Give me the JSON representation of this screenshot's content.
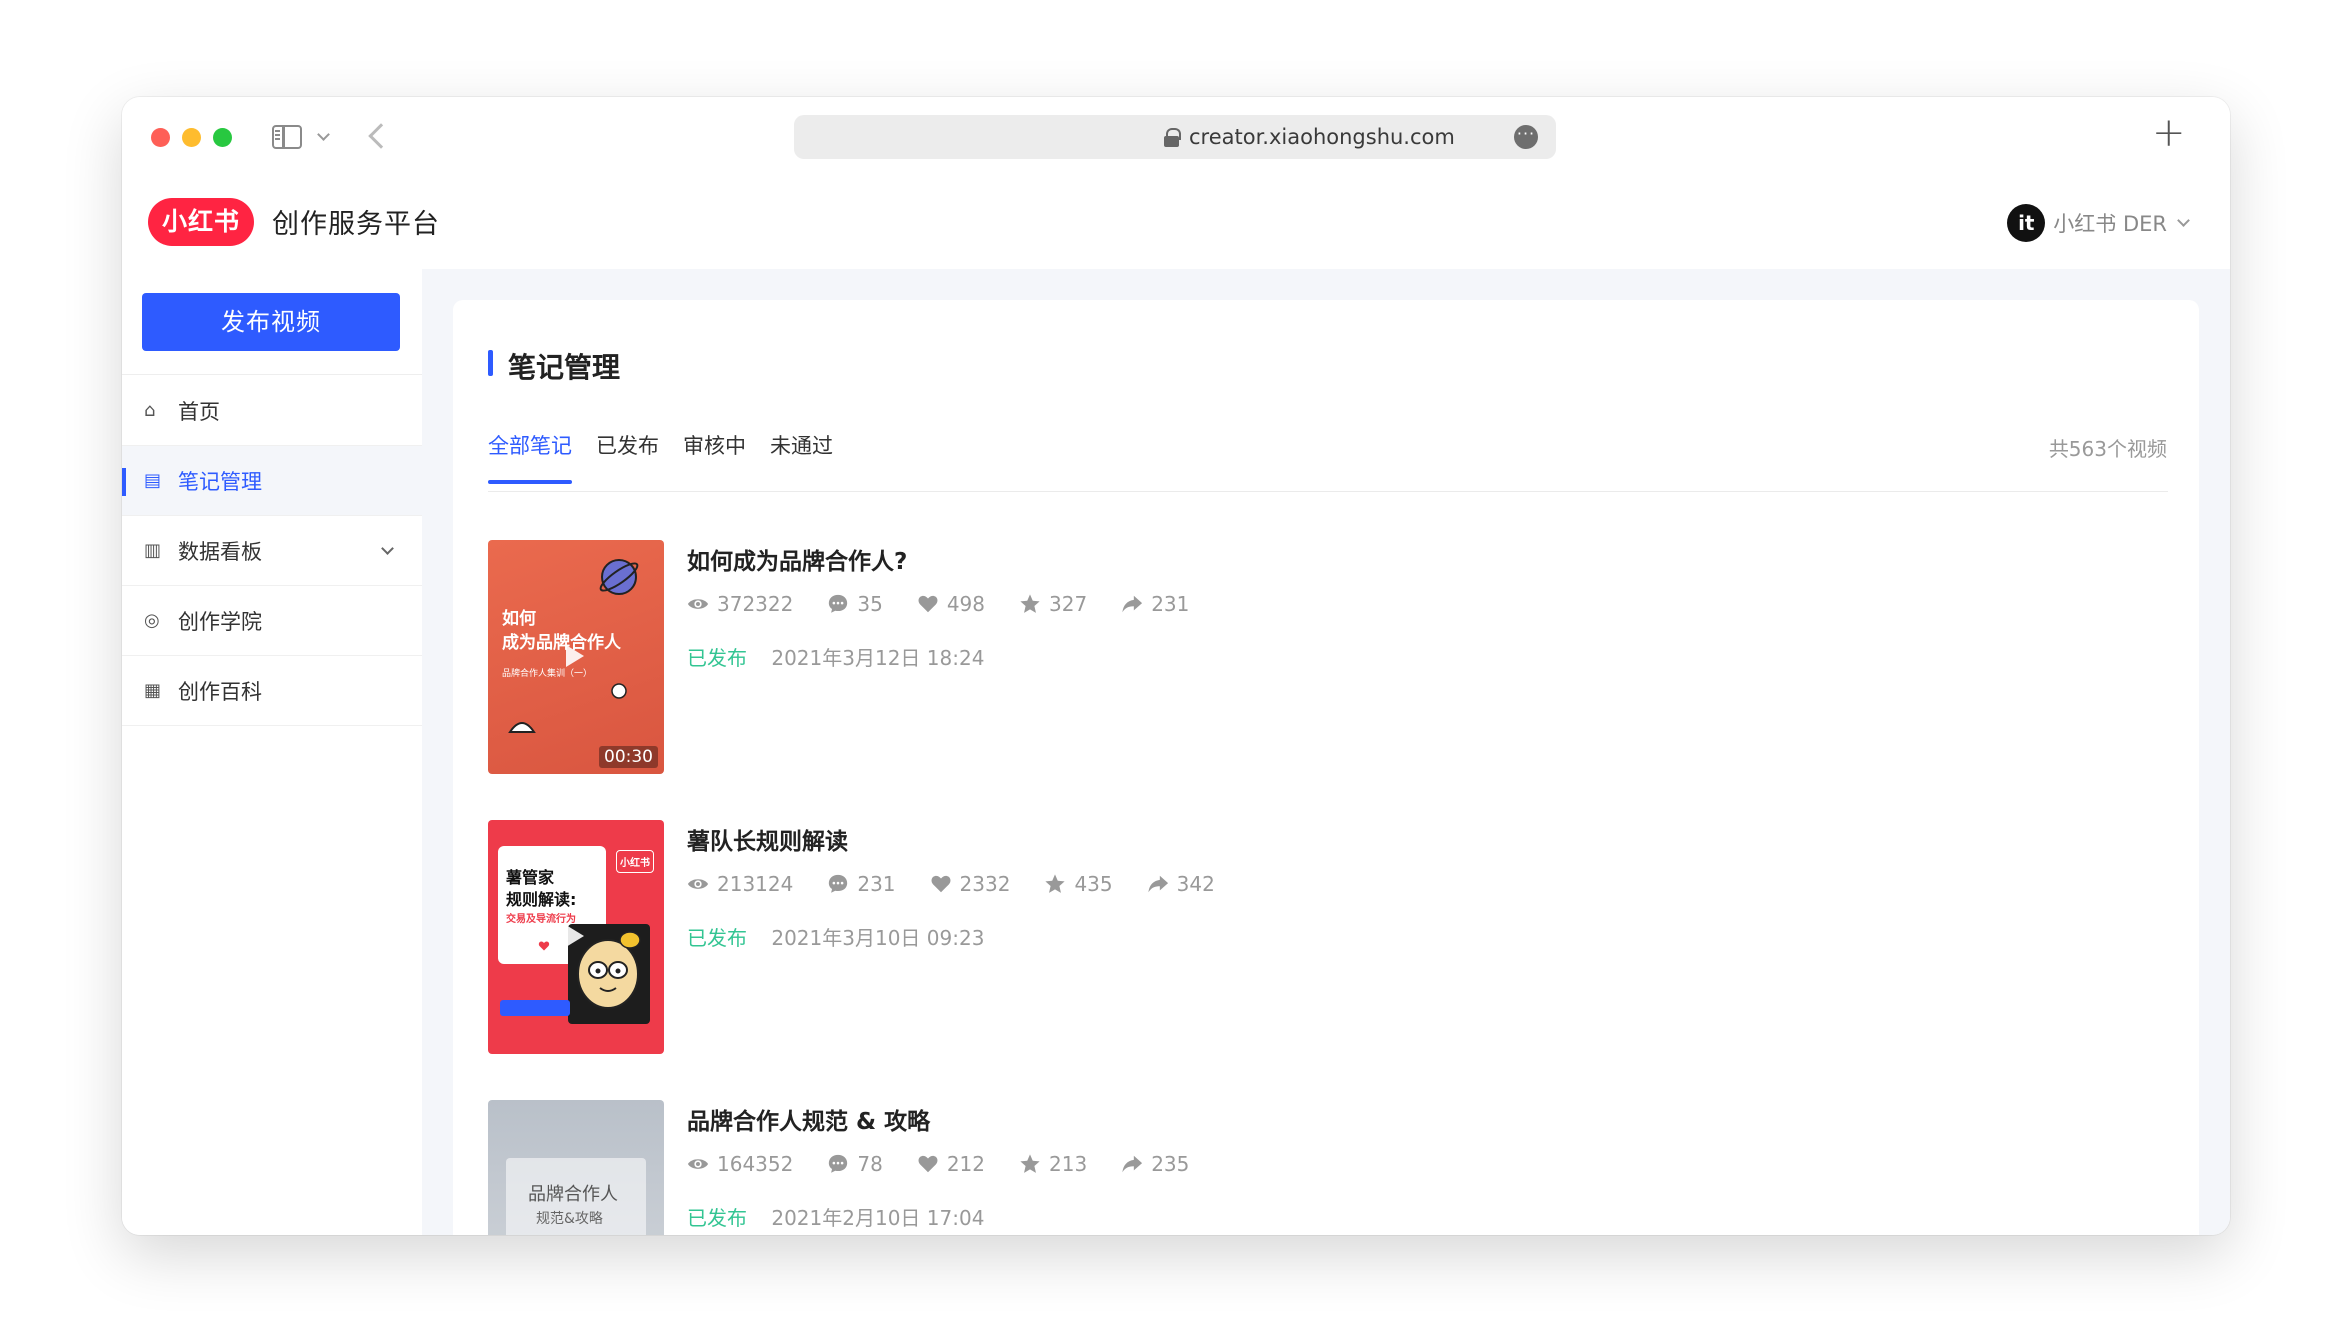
{
  "browser": {
    "url": "creator.xiaohongshu.com",
    "more_label": "···",
    "plus_label": "+"
  },
  "header": {
    "logo_text": "小红书",
    "platform_title": "创作服务平台",
    "user_avatar_text": "it",
    "user_name": "小红书 DER"
  },
  "sidebar": {
    "publish_button": "发布视频",
    "items": [
      {
        "label": "首页",
        "icon": "home-icon",
        "glyph": "⌂"
      },
      {
        "label": "笔记管理",
        "icon": "note-icon",
        "glyph": "▤"
      },
      {
        "label": "数据看板",
        "icon": "bar-chart-icon",
        "glyph": "▥"
      },
      {
        "label": "创作学院",
        "icon": "planet-icon",
        "glyph": "◎"
      },
      {
        "label": "创作百科",
        "icon": "book-icon",
        "glyph": "▦"
      }
    ]
  },
  "main": {
    "page_title": "笔记管理",
    "tabs": [
      "全部笔记",
      "已发布",
      "审核中",
      "未通过"
    ],
    "total_count": "共563个视频",
    "notes": [
      {
        "title": "如何成为品牌合作人?",
        "views": "372322",
        "comments": "35",
        "likes": "498",
        "favorites": "327",
        "shares": "231",
        "status": "已发布",
        "time": "2021年3月12日 18:24",
        "thumb_line1": "如何",
        "thumb_line2": "成为品牌合作人",
        "thumb_sub": "品牌合作人集训（一）",
        "duration": "00:30"
      },
      {
        "title": "薯队长规则解读",
        "views": "213124",
        "comments": "231",
        "likes": "2332",
        "favorites": "435",
        "shares": "342",
        "status": "已发布",
        "time": "2021年3月10日 09:23",
        "thumb_line1": "薯管家",
        "thumb_line2": "规则解读:",
        "thumb_sub": "交易及导流行为",
        "thumb_logo": "小红书"
      },
      {
        "title": "品牌合作人规范 & 攻略",
        "views": "164352",
        "comments": "78",
        "likes": "212",
        "favorites": "213",
        "shares": "235",
        "status": "已发布",
        "time": "2021年2月10日 17:04",
        "thumb_line1": "品牌合作人",
        "thumb_line2": "规范&攻略"
      }
    ]
  },
  "colors": {
    "brand_red": "#ff2442",
    "accent_blue": "#2e5bff",
    "status_green": "#33c593"
  }
}
